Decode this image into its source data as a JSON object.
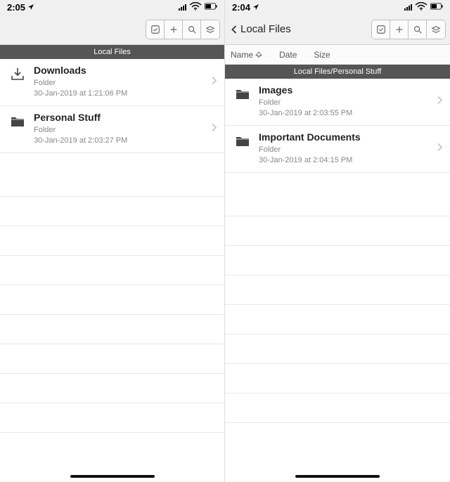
{
  "left": {
    "status_time": "2:05",
    "header_title": "Local Files",
    "items": [
      {
        "name": "Downloads",
        "type": "Folder",
        "detail": "30-Jan-2019 at 1:21:06 PM",
        "icon": "download"
      },
      {
        "name": "Personal Stuff",
        "type": "Folder",
        "detail": "30-Jan-2019 at 2:03:27 PM",
        "icon": "folder"
      }
    ]
  },
  "right": {
    "status_time": "2:04",
    "back_label": "Local Files",
    "sort": {
      "col1": "Name",
      "col2": "Date",
      "col3": "Size"
    },
    "header_title": "Local Files/Personal Stuff",
    "items": [
      {
        "name": "Images",
        "type": "Folder",
        "detail": "30-Jan-2019 at 2:03:55 PM",
        "icon": "folder"
      },
      {
        "name": "Important Documents",
        "type": "Folder",
        "detail": "30-Jan-2019 at 2:04:15 PM",
        "icon": "folder"
      }
    ]
  },
  "icons": {
    "download": "download-tray-icon",
    "folder": "folder-icon"
  }
}
